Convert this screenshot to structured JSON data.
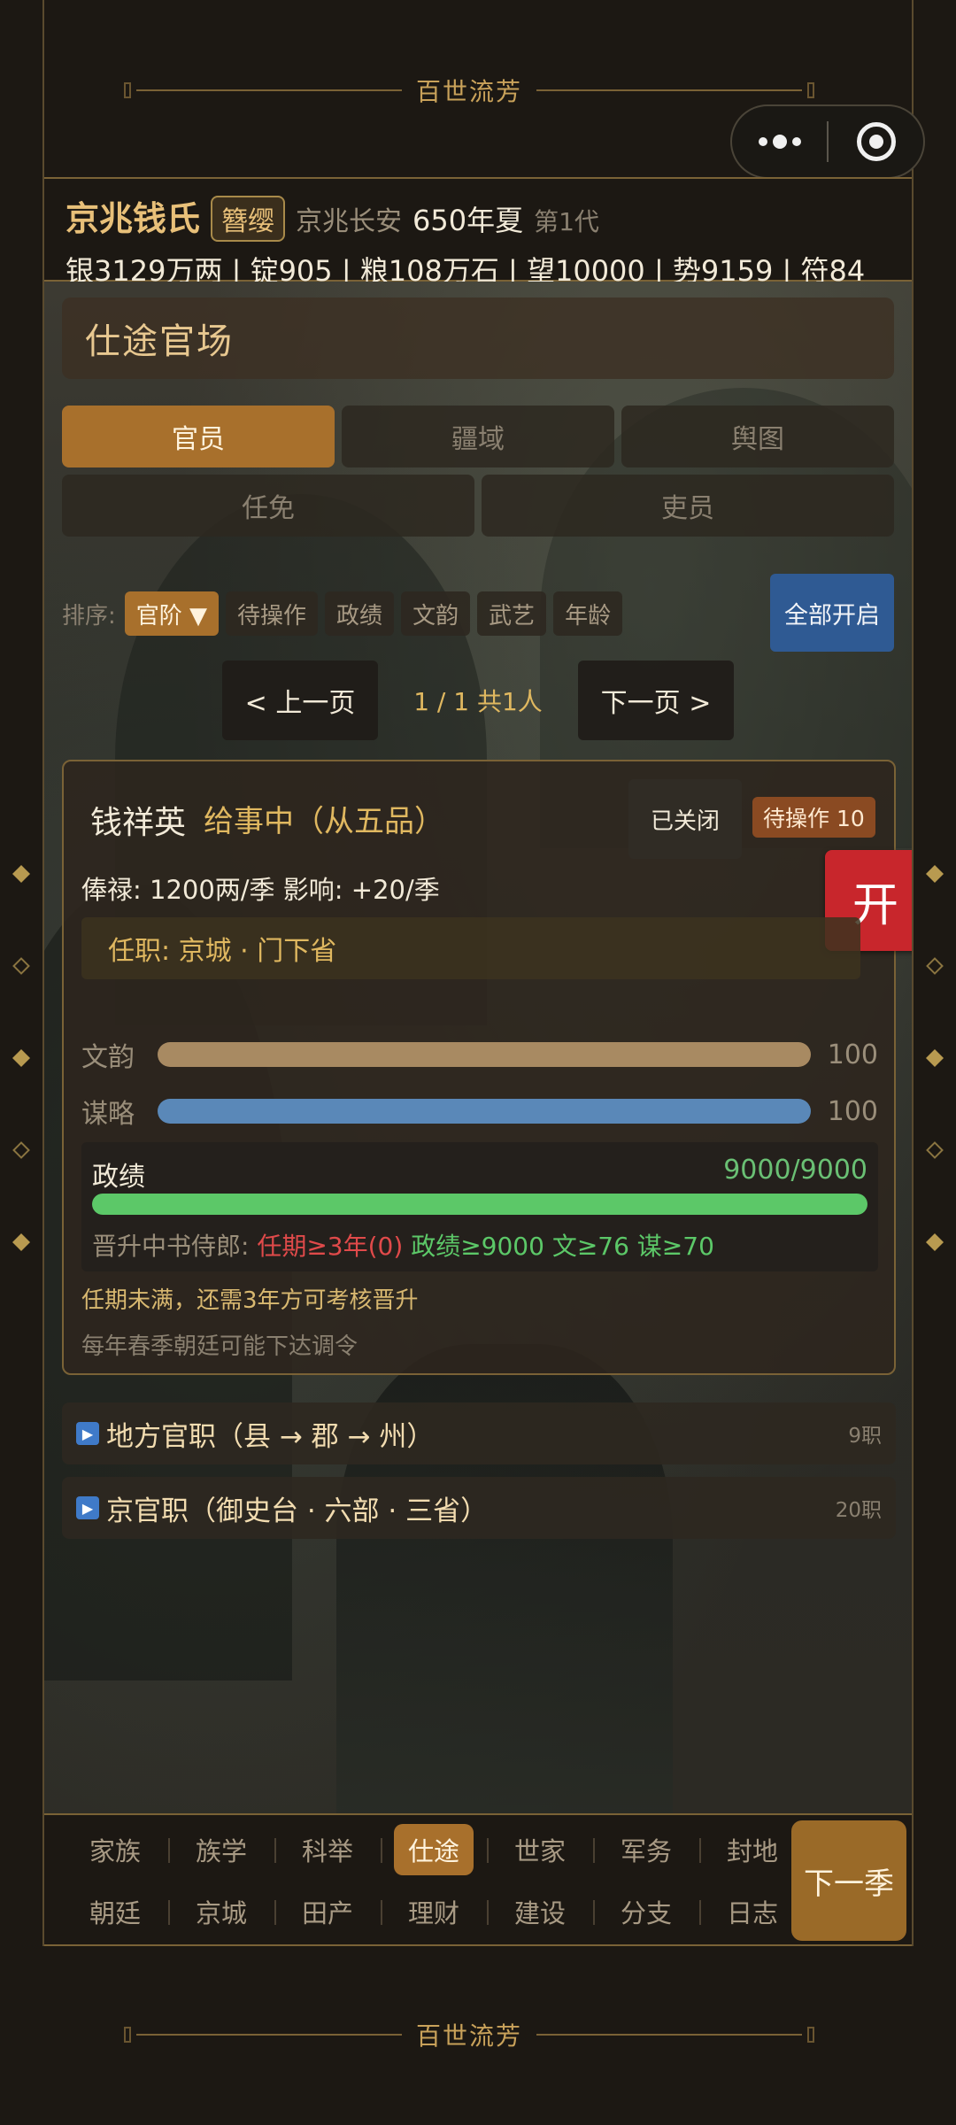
{
  "banner": {
    "title": "百世流芳"
  },
  "header": {
    "clan": "京兆钱氏",
    "rank_badge": "簪缨",
    "place": "京兆长安",
    "season": "650年夏",
    "generation": "第1代",
    "resources": "银3129万两 | 锭905 | 粮108万石 | 望10000 | 势9159 | 符84"
  },
  "section": {
    "title": "仕途官场"
  },
  "tabs_primary": [
    {
      "label": "官员",
      "active": true
    },
    {
      "label": "疆域",
      "active": false
    },
    {
      "label": "舆图",
      "active": false
    }
  ],
  "tabs_secondary": [
    {
      "label": "任免"
    },
    {
      "label": "吏员"
    }
  ],
  "sort": {
    "label": "排序:",
    "chips": [
      "官阶 ▼",
      "待操作",
      "政绩",
      "文韵",
      "武艺",
      "年龄"
    ],
    "open_all": "全部开启"
  },
  "pager": {
    "prev": "< 上一页",
    "info": "1 / 1  共1人",
    "next": "下一页 >"
  },
  "official": {
    "name": "钱祥英",
    "title": "给事中（从五品）",
    "closed": "已关闭",
    "pending": "待操作 10",
    "open_button": "开",
    "salary": "俸禄: 1200两/季   影响: +20/季",
    "post": "任职: 京城 · 门下省",
    "stats": [
      {
        "label": "文韵",
        "value": 100,
        "display": "100",
        "color": "#a88a62"
      },
      {
        "label": "谋略",
        "value": 100,
        "display": "100",
        "color": "#5a88b8"
      }
    ],
    "performance": {
      "label": "政绩",
      "value": "9000/9000",
      "fraction": 1.0,
      "req_prefix": "晋升中书侍郎: ",
      "req_fail": "任期≥3年(0)",
      "req_pass": " 政绩≥9000  文≥76  谋≥70"
    },
    "note1": "任期未满，还需3年方可考核晋升",
    "note2": "每年春季朝廷可能下达调令"
  },
  "groups": [
    {
      "icon": "▶",
      "name": "地方官职（县 → 郡 → 州）",
      "count": "9职"
    },
    {
      "icon": "▶",
      "name": "京官职（御史台 · 六部 · 三省）",
      "count": "20职"
    }
  ],
  "nav": {
    "row1": [
      {
        "label": "家族"
      },
      {
        "label": "族学"
      },
      {
        "label": "科举"
      },
      {
        "label": "仕途",
        "active": true
      },
      {
        "label": "世家"
      },
      {
        "label": "军务"
      },
      {
        "label": "封地"
      }
    ],
    "row2": [
      {
        "label": "朝廷"
      },
      {
        "label": "京城"
      },
      {
        "label": "田产"
      },
      {
        "label": "理财"
      },
      {
        "label": "建设"
      },
      {
        "label": "分支"
      },
      {
        "label": "日志"
      }
    ],
    "next_season": "下一季"
  }
}
